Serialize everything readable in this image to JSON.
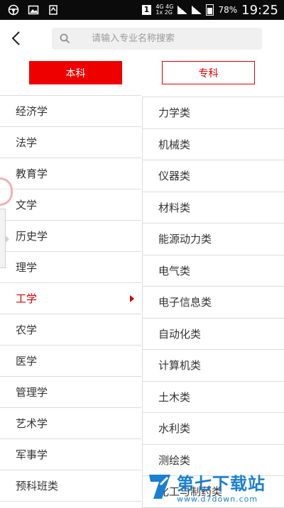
{
  "status_bar": {
    "sim_slot": "1",
    "net_top": "4G 4G",
    "net_bottom": "1x 2G",
    "battery_percent": "78%",
    "time": "19:25"
  },
  "header": {
    "search_placeholder": "请输入专业名称搜索"
  },
  "segments": {
    "undergrad_label": "本科",
    "junior_college_label": "专科"
  },
  "left_categories": [
    "经济学",
    "法学",
    "教育学",
    "文学",
    "历史学",
    "理学",
    "工学",
    "农学",
    "医学",
    "管理学",
    "艺术学",
    "军事学",
    "预科班类"
  ],
  "selected_index": 6,
  "right_subcategories": [
    "力学类",
    "机械类",
    "仪器类",
    "材料类",
    "能源动力类",
    "电气类",
    "电子信息类",
    "自动化类",
    "计算机类",
    "土木类",
    "水利类",
    "测绘类",
    "化工与制药类"
  ],
  "watermark": {
    "title": "第七下载站",
    "url": "www.d7down.com"
  },
  "colors": {
    "accent": "#ee0000",
    "selected_text": "#d40000",
    "watermark": "#1a7fd1"
  }
}
